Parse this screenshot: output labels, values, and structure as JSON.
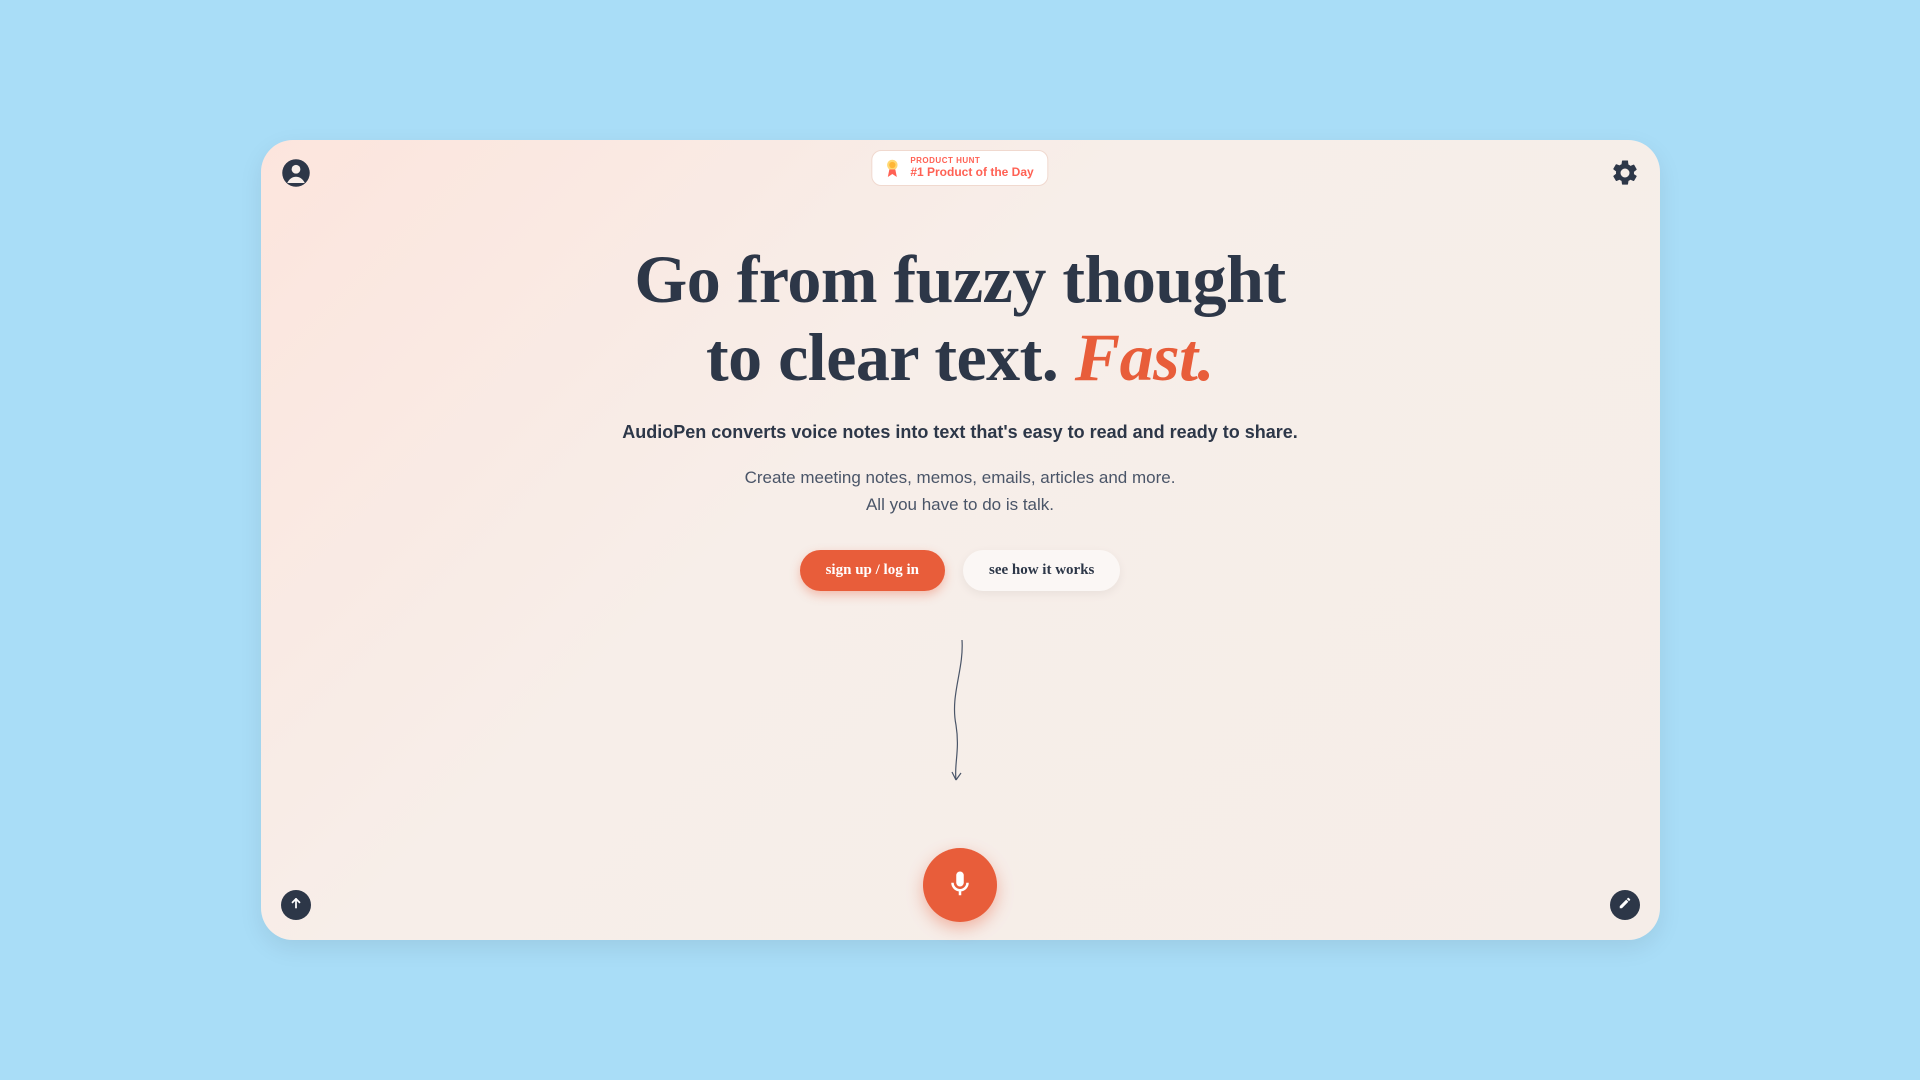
{
  "badge": {
    "label": "PRODUCT HUNT",
    "title": "#1 Product of the Day"
  },
  "hero": {
    "headline_a": "Go from fuzzy thought",
    "headline_b": "to clear text.",
    "headline_fast": "Fast.",
    "subhead": "AudioPen converts voice notes into text that's easy to read and ready to share.",
    "desc_line1": "Create meeting notes, memos, emails, articles and more.",
    "desc_line2": "All you have to do is talk."
  },
  "buttons": {
    "signup": "sign up / log in",
    "demo": "see how it works"
  },
  "colors": {
    "accent": "#e85d3a",
    "text_dark": "#2d3748",
    "page_bg": "#a9ddf7"
  }
}
